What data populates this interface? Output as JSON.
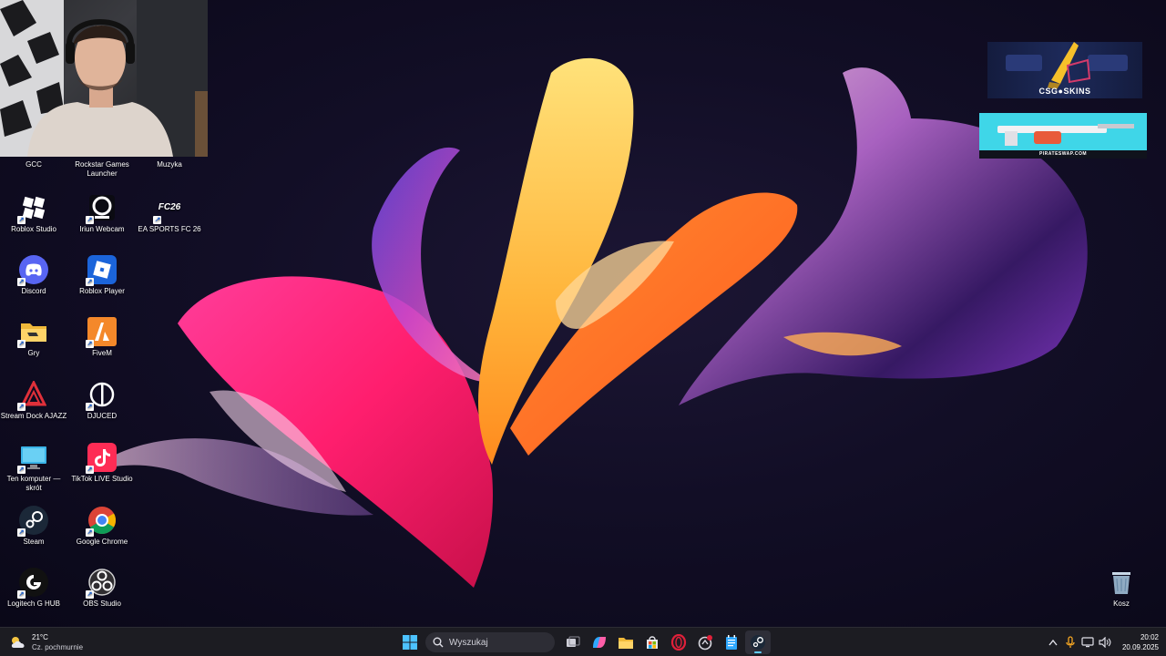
{
  "desktop_icons": [
    {
      "label": "GCC"
    },
    {
      "label": "Rockstar Games Launcher"
    },
    {
      "label": "Muzyka"
    },
    {
      "label": "Roblox Studio",
      "icon": "roblox-studio-icon"
    },
    {
      "label": "Iriun Webcam",
      "icon": "webcam-icon"
    },
    {
      "label": "EA SPORTS FC 26",
      "icon": "fc26-icon",
      "icon_text": "FC26"
    },
    {
      "label": "Discord",
      "icon": "discord-icon"
    },
    {
      "label": "Roblox Player",
      "icon": "roblox-icon"
    },
    {
      "label": "Gry",
      "icon": "folder-icon"
    },
    {
      "label": "FiveM",
      "icon": "fivem-icon"
    },
    {
      "label": "Stream Dock AJAZZ",
      "icon": "stream-dock-icon"
    },
    {
      "label": "DJUCED",
      "icon": "djuced-icon"
    },
    {
      "label": "Ten komputer — skrót",
      "icon": "monitor-icon"
    },
    {
      "label": "TikTok LIVE Studio",
      "icon": "tiktok-icon"
    },
    {
      "label": "Steam",
      "icon": "steam-icon"
    },
    {
      "label": "Google Chrome",
      "icon": "chrome-icon"
    },
    {
      "label": "Logitech G HUB",
      "icon": "logitech-icon"
    },
    {
      "label": "OBS Studio",
      "icon": "obs-icon"
    }
  ],
  "recycle_bin": {
    "label": "Kosz"
  },
  "promos": {
    "csgo_label": "CSG●SKINS",
    "pirate_label": "PIRATESWAP.COM"
  },
  "taskbar": {
    "weather_temp": "21°C",
    "weather_desc": "Cz. pochmurnie",
    "search_placeholder": "Wyszukaj",
    "time": "20:02",
    "date": "20.09.2025"
  },
  "colors": {
    "accent": "#60cdff",
    "taskbar_bg": "#1c1c22",
    "discord": "#5865f2",
    "roblox": "#1b64da"
  }
}
